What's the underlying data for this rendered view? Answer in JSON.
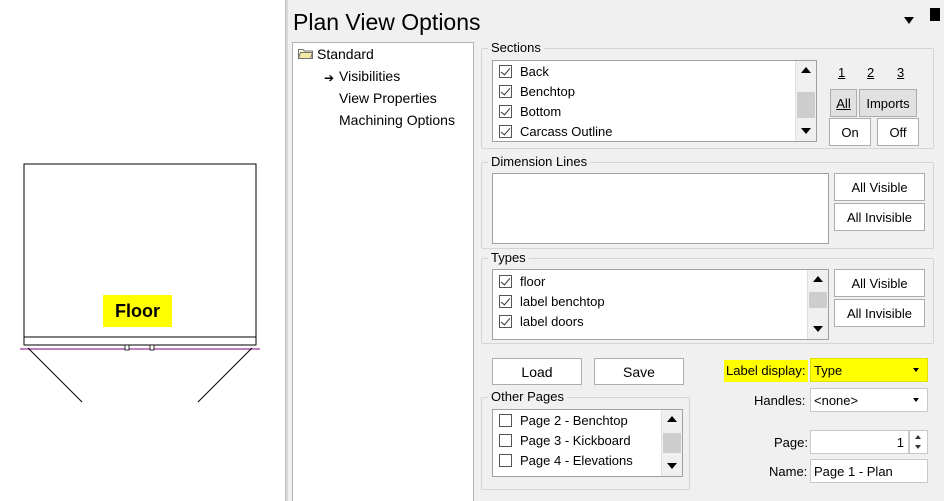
{
  "drawing": {
    "floor_label": "Floor"
  },
  "panel": {
    "title": "Plan View Options"
  },
  "tree": {
    "root": "Standard",
    "items": [
      "Visibilities",
      "View Properties",
      "Machining Options"
    ]
  },
  "sections": {
    "title": "Sections",
    "items": [
      {
        "label": "Back",
        "checked": true
      },
      {
        "label": "Benchtop",
        "checked": true
      },
      {
        "label": "Bottom",
        "checked": true
      },
      {
        "label": "Carcass Outline",
        "checked": true
      }
    ],
    "page_links": [
      "1",
      "2",
      "3"
    ],
    "all_label": "All",
    "imports_label": "Imports",
    "on_label": "On",
    "off_label": "Off"
  },
  "dimension_lines": {
    "title": "Dimension Lines",
    "all_visible": "All Visible",
    "all_invisible": "All Invisible"
  },
  "types": {
    "title": "Types",
    "items": [
      {
        "label": "floor",
        "checked": true
      },
      {
        "label": "label benchtop",
        "checked": true
      },
      {
        "label": "label doors",
        "checked": true
      }
    ],
    "all_visible": "All Visible",
    "all_invisible": "All Invisible"
  },
  "actions": {
    "load": "Load",
    "save": "Save"
  },
  "other_pages": {
    "title": "Other Pages",
    "items": [
      {
        "label": "Page 2 - Benchtop",
        "checked": false
      },
      {
        "label": "Page 3 - Kickboard",
        "checked": false
      },
      {
        "label": "Page 4 - Elevations",
        "checked": false
      }
    ]
  },
  "fields": {
    "label_display_label": "Label display:",
    "label_display_value": "Type",
    "handles_label": "Handles:",
    "handles_value": "<none>",
    "page_label": "Page:",
    "page_value": "1",
    "name_label": "Name:",
    "name_value": "Page 1 - Plan"
  },
  "colors": {
    "highlight": "#ffff00",
    "panel_bg": "#f0f0f0",
    "cabinet_line": "#800080"
  }
}
